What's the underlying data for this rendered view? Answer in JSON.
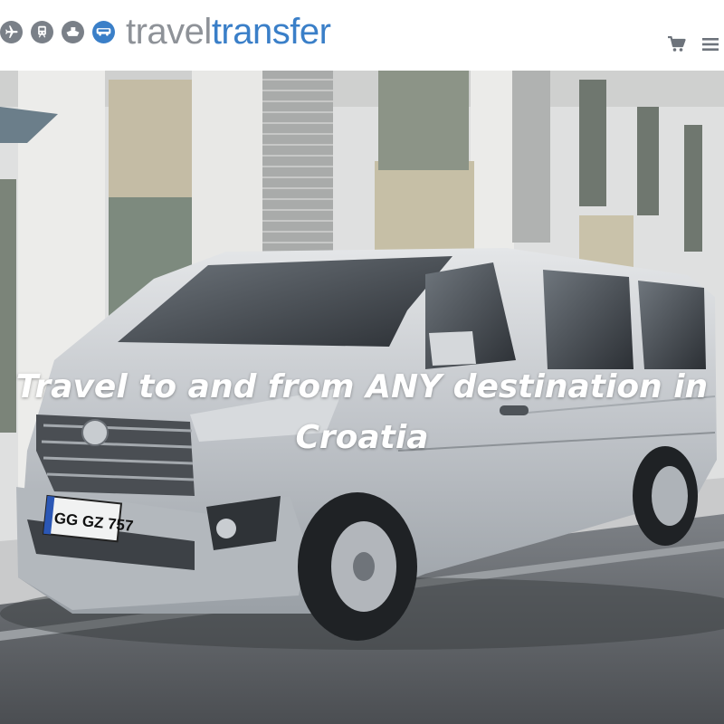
{
  "header": {
    "logo": {
      "part1": "travel",
      "part2": "transfer"
    },
    "mode_icons": [
      "airplane-icon",
      "train-icon",
      "ship-icon",
      "bus-icon"
    ],
    "actions": [
      "cart-icon",
      "menu-icon"
    ]
  },
  "hero": {
    "title": "Travel to and from ANY destination in Croatia",
    "plate": "GG GZ 757"
  },
  "colors": {
    "brand_blue": "#3a7fc8",
    "brand_gray": "#8e9298"
  }
}
